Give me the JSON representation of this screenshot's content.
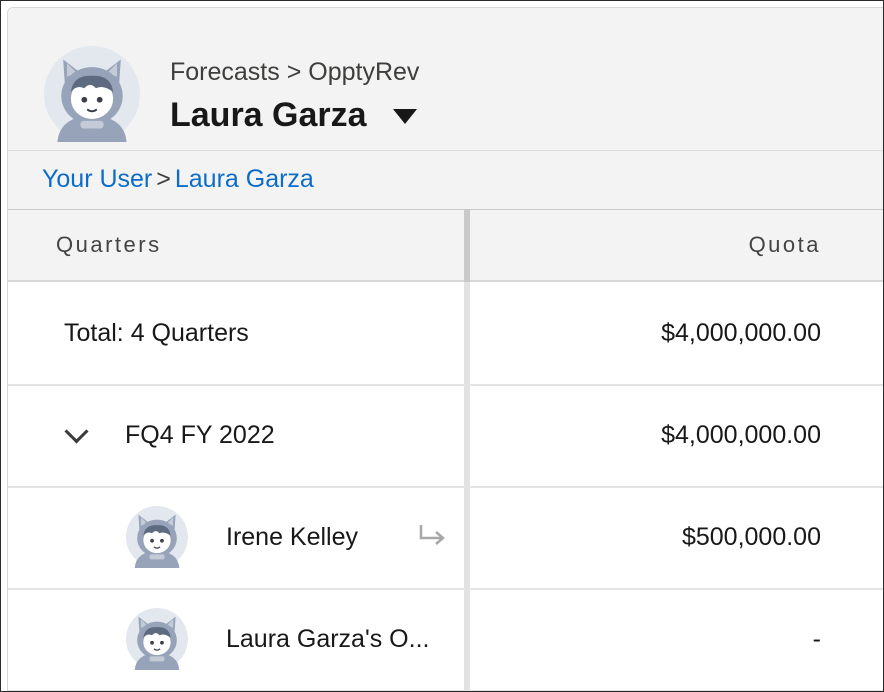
{
  "header": {
    "breadcrumb": "Forecasts > OpptyRev",
    "title": "Laura Garza",
    "avatar_icon": "user-avatar-icon",
    "dropdown_icon": "caret-down-icon"
  },
  "hierarchy": {
    "root_link": "Your User",
    "separator": ">",
    "current_link": "Laura Garza"
  },
  "table": {
    "columns": [
      "Quarters",
      "Quota"
    ],
    "rows": [
      {
        "label": "Total: 4 Quarters",
        "quota": "$4,000,000.00"
      },
      {
        "label": "FQ4 FY 2022",
        "quota": "$4,000,000.00",
        "icon": "chevron-down-icon"
      },
      {
        "label": "Irene Kelley",
        "quota": "$500,000.00",
        "icon": "user-avatar-icon",
        "action_icon": "delegate-arrow-icon"
      },
      {
        "label": "Laura Garza's O...",
        "quota": "-",
        "icon": "user-avatar-icon"
      }
    ]
  },
  "colors": {
    "link": "#0b6cc9",
    "header_bg": "#f3f3f3",
    "avatar_body": "#aab4c6"
  }
}
